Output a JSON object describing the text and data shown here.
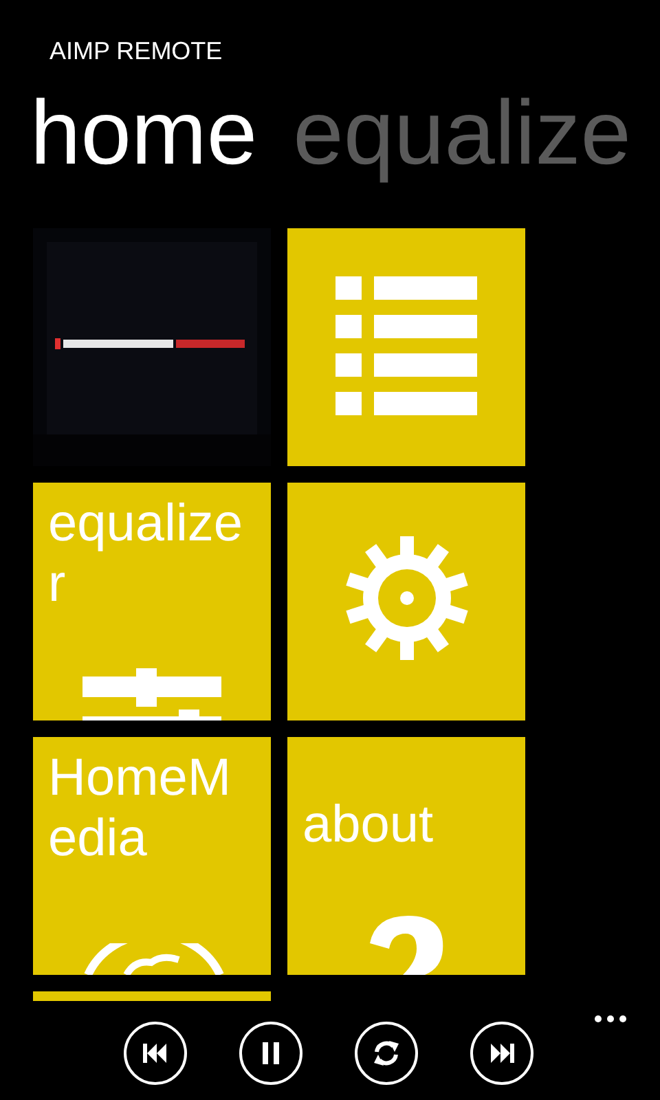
{
  "app_title": "AIMP REMOTE",
  "pivot": [
    {
      "label": "home",
      "selected": true
    },
    {
      "label": "equalize",
      "selected": false
    }
  ],
  "tiles": [
    {
      "kind": "album_art"
    },
    {
      "kind": "playlist"
    },
    {
      "kind": "equalizer",
      "label": "equalizer"
    },
    {
      "kind": "settings"
    },
    {
      "kind": "homemedia",
      "label": "HomeMedia"
    },
    {
      "kind": "about",
      "label": "about"
    },
    {
      "kind": "blank"
    }
  ],
  "app_bar": [
    {
      "kind": "previous"
    },
    {
      "kind": "pause"
    },
    {
      "kind": "repeat"
    },
    {
      "kind": "next"
    }
  ]
}
